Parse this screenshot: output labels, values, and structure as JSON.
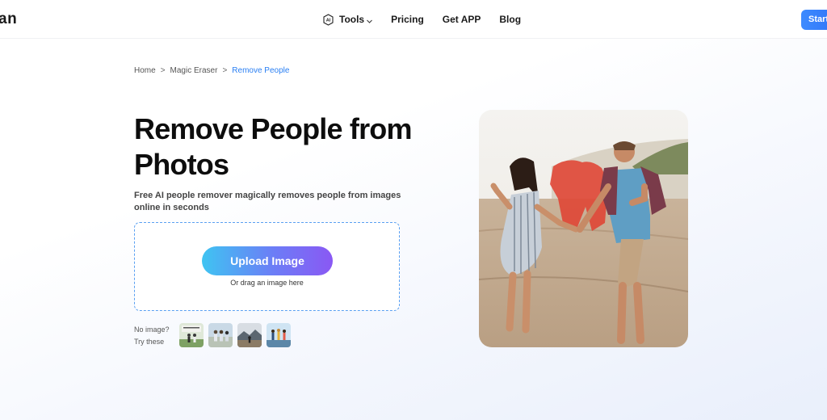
{
  "header": {
    "logo_text": "an",
    "nav": {
      "tools_label": "Tools",
      "pricing_label": "Pricing",
      "getapp_label": "Get APP",
      "blog_label": "Blog"
    },
    "start_label": "Start"
  },
  "breadcrumb": {
    "items": [
      "Home",
      "Magic Eraser",
      "Remove People"
    ],
    "separator": ">"
  },
  "hero": {
    "title": "Remove People from Photos",
    "subtitle": "Free AI people remover magically removes people from images online in seconds",
    "upload_label": "Upload Image",
    "drag_hint": "Or drag an image here",
    "sample_label_line1": "No image?",
    "sample_label_line2": "Try these"
  },
  "colors": {
    "accent": "#2a7ff3",
    "upload_gradient_start": "#3fc4f2",
    "upload_gradient_end": "#8a58f4",
    "removal_highlight": "#e0402f"
  },
  "icons": {
    "tools": "ai-icon",
    "tools_dropdown": "chevron-down-icon"
  }
}
